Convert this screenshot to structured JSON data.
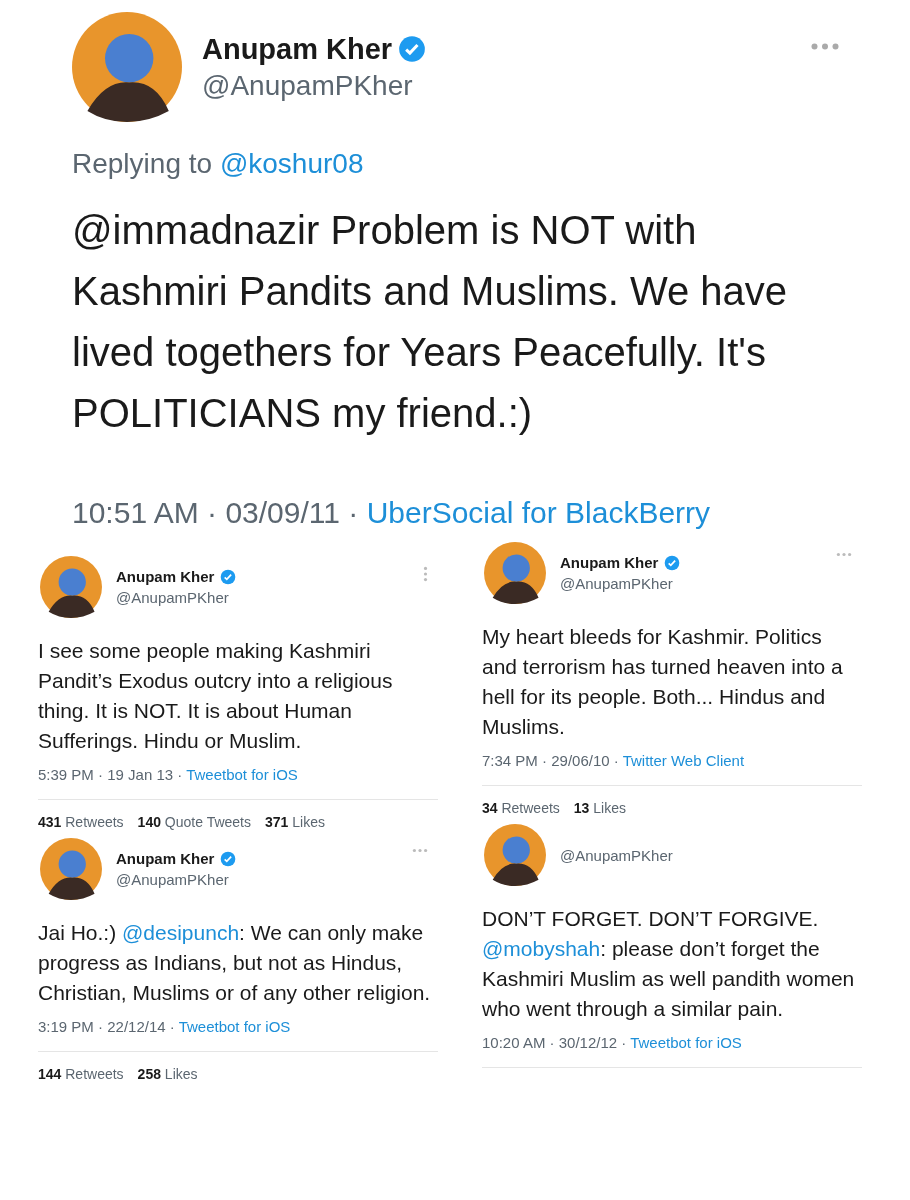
{
  "main_tweet": {
    "name": "Anupam Kher",
    "verified": true,
    "handle": "@AnupamPKher",
    "menu": {
      "kind": "horizontal"
    },
    "reply_to": {
      "label": "Replying to",
      "mention": "@koshur08"
    },
    "body": [
      {
        "kind": "text",
        "text": "@immadnazir Problem is NOT with Kashmiri Pandits and Muslims. We have lived togethers for Years Peacefully. It's POLITICIANS my friend.:)"
      }
    ],
    "meta": "10:51 AM · 03/09/11 · ",
    "source": "UberSocial for BlackBerry"
  },
  "columns": [
    [
      {
        "name": "Anupam Kher",
        "verified": true,
        "handle": "@AnupamPKher",
        "menu": {
          "kind": "vertical"
        },
        "body": [
          {
            "kind": "text",
            "text": "I see some people making Kashmiri Pandit’s Exodus outcry into a religious thing. It is NOT. It is about Human Sufferings. Hindu or Muslim."
          }
        ],
        "meta": "5:39 PM · 19 Jan 13 · ",
        "source": "Tweetbot for iOS",
        "stats": [
          {
            "count": "431",
            "label": "Retweets"
          },
          {
            "count": "140",
            "label": "Quote Tweets"
          },
          {
            "count": "371",
            "label": "Likes"
          }
        ]
      },
      {
        "name": "Anupam Kher",
        "verified": true,
        "handle": "@AnupamPKher",
        "menu": {
          "kind": "horizontal"
        },
        "body": [
          {
            "kind": "text",
            "text": "Jai Ho.:) "
          },
          {
            "kind": "mention",
            "text": "@desipunch"
          },
          {
            "kind": "text",
            "text": ": We can only make progress as Indians, but not as Hindus, Christian, Muslims or of any other religion."
          }
        ],
        "meta": "3:19 PM · 22/12/14 · ",
        "source": "Tweetbot for iOS",
        "stats": [
          {
            "count": "144",
            "label": "Retweets"
          },
          {
            "count": "258",
            "label": "Likes"
          }
        ]
      }
    ],
    [
      {
        "name": "Anupam Kher",
        "verified": true,
        "handle": "@AnupamPKher",
        "menu": {
          "kind": "horizontal"
        },
        "body": [
          {
            "kind": "text",
            "text": "My heart bleeds for Kashmir. Politics and terrorism has turned heaven into a hell for its people. Both... Hindus and Muslims."
          }
        ],
        "meta": "7:34 PM · 29/06/10 · ",
        "source": "Twitter Web Client",
        "stats": [
          {
            "count": "34",
            "label": "Retweets"
          },
          {
            "count": "13",
            "label": "Likes"
          }
        ]
      },
      {
        "handle": "@AnupamPKher",
        "body": [
          {
            "kind": "text",
            "text": "DON’T FORGET. DON’T FORGIVE. "
          },
          {
            "kind": "mention",
            "text": "@mobyshah"
          },
          {
            "kind": "text",
            "text": ": please don’t forget the Kashmiri Muslim as well pandith women who went through a similar pain."
          }
        ],
        "meta": "10:20 AM · 30/12/12 · ",
        "source": "Tweetbot for iOS"
      }
    ]
  ]
}
